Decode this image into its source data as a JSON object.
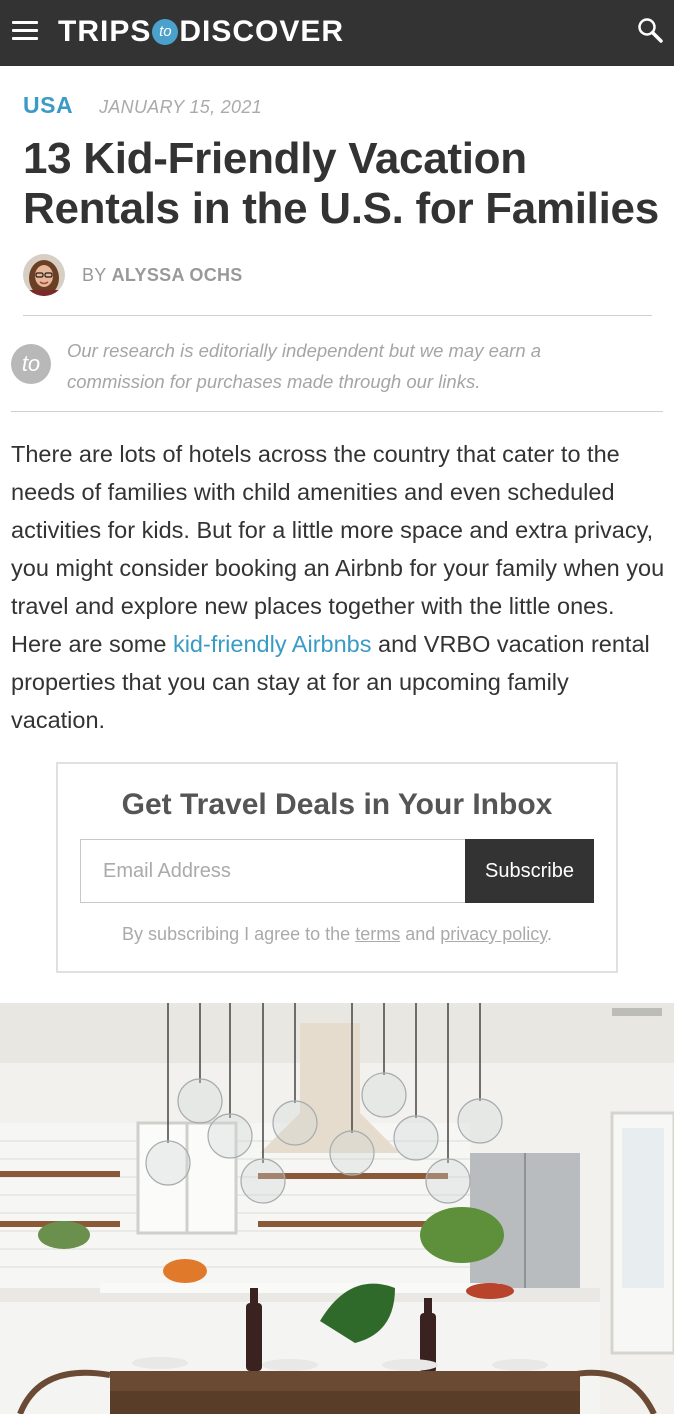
{
  "header": {
    "logo_left": "TRIPS",
    "logo_badge": "to",
    "logo_right": "DISCOVER",
    "menu_icon": "hamburger-menu-icon",
    "search_icon": "search-icon"
  },
  "article": {
    "category": "USA",
    "date": "JANUARY 15, 2021",
    "title": "13 Kid-Friendly Vacation Rentals in the U.S. for Families",
    "byline_prefix": "BY",
    "author": "ALYSSA OCHS",
    "disclosure_badge": "to",
    "disclosure": "Our research is editorially independent but we may earn a commission for purchases made through our links.",
    "intro_before": "There are lots of hotels across the country that cater to the needs of families with child amenities and even scheduled activities for kids. But for a little more space and extra privacy, you might consider booking an Airbnb for your family when you travel and explore new places together with the little ones. Here are some ",
    "intro_link": "kid-friendly Airbnbs",
    "intro_after": " and VRBO vacation rental properties that you can stay at for an upcoming family vacation."
  },
  "newsletter": {
    "title": "Get Travel Deals in Your Inbox",
    "email_placeholder": "Email Address",
    "subscribe_label": "Subscribe",
    "terms_before": "By subscribing I agree to the ",
    "terms_link": "terms",
    "terms_middle": " and ",
    "privacy_link": "privacy policy",
    "terms_after": "."
  },
  "colors": {
    "header_bg": "#333333",
    "accent": "#3a9bc6",
    "button_bg": "#333333"
  }
}
